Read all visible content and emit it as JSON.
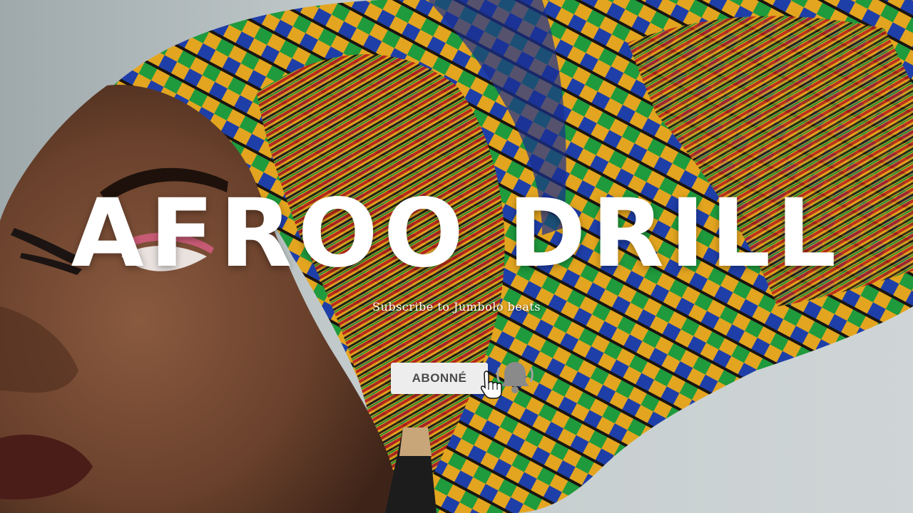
{
  "video_title": "AFROO DRILL",
  "subtitle": "Subscribe to Jumbolo beats",
  "subscribe_button": {
    "label": "ABONNÉ",
    "state": "subscribed"
  },
  "icons": {
    "bell": "bell-icon",
    "cursor": "hand-pointer-icon"
  },
  "colors": {
    "title_text": "#ffffff",
    "button_bg": "#ededed",
    "button_text": "#4a4a4a",
    "bell": "#8a8a8a"
  }
}
